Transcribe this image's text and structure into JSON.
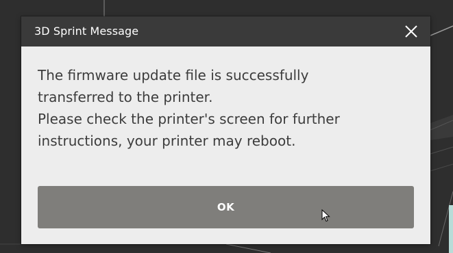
{
  "dialog": {
    "title": "3D Sprint Message",
    "close_icon": "close-icon",
    "message_lines": [
      "The firmware update file is successfully",
      "transferred to the printer.",
      "Please check the printer's screen for further",
      "instructions, your printer may reboot."
    ],
    "ok_label": "OK"
  },
  "colors": {
    "titlebar": "#3a3a3a",
    "body": "#ededed",
    "button": "#7f7e7b",
    "text": "#3c3c3c"
  }
}
